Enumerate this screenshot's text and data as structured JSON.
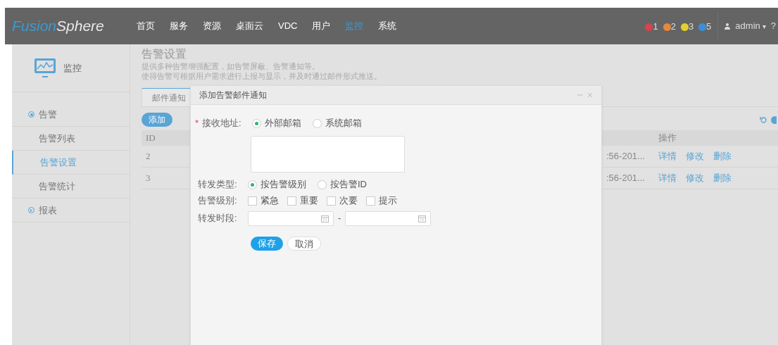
{
  "header": {
    "logo": {
      "part1": "Fusion",
      "part2": "Sphere"
    },
    "nav": [
      {
        "label": "首页",
        "selected": false
      },
      {
        "label": "服务",
        "selected": false
      },
      {
        "label": "资源",
        "selected": false
      },
      {
        "label": "桌面云",
        "selected": false
      },
      {
        "label": "VDC",
        "selected": false
      },
      {
        "label": "用户",
        "selected": false
      },
      {
        "label": "监控",
        "selected": true
      },
      {
        "label": "系统",
        "selected": false
      }
    ],
    "alarms": [
      {
        "count": "1",
        "color": "#d9434e"
      },
      {
        "count": "2",
        "color": "#e8883a"
      },
      {
        "count": "3",
        "color": "#e3cf2e"
      },
      {
        "count": "5",
        "color": "#3b8fd9"
      }
    ],
    "user": "admin",
    "user_caret": "▾",
    "help": "?"
  },
  "sidebar": {
    "title": "监控",
    "items": [
      {
        "label": "告警",
        "kind": "group",
        "expanded": true,
        "selected": false
      },
      {
        "label": "告警列表",
        "kind": "item",
        "selected": false
      },
      {
        "label": "告警设置",
        "kind": "item",
        "selected": true
      },
      {
        "label": "告警统计",
        "kind": "item",
        "selected": false
      },
      {
        "label": "报表",
        "kind": "group",
        "expanded": false,
        "selected": false
      }
    ]
  },
  "page": {
    "title": "告警设置",
    "description": [
      "提供多种告警增强配置，如告警屏蔽、告警通知等。",
      "使得告警可根据用户需求进行上报与显示，并及时通过邮件形式推送。"
    ],
    "tabs": [
      {
        "label": "邮件通知",
        "selected": true
      }
    ],
    "add_button": "添加",
    "table": {
      "columns": [
        "ID",
        "操作"
      ],
      "rows": [
        {
          "id": "2",
          "time": ":56-201...",
          "actions": [
            "详情",
            "修改",
            "删除"
          ]
        },
        {
          "id": "3",
          "time": ":56-201...",
          "actions": [
            "详情",
            "修改",
            "删除"
          ]
        }
      ]
    }
  },
  "dialog": {
    "title": "添加告警邮件通知",
    "receive": {
      "label": "接收地址:",
      "required_mark": "*",
      "options": [
        {
          "label": "外部邮箱",
          "selected": true
        },
        {
          "label": "系统邮箱",
          "selected": false
        }
      ]
    },
    "forward_type": {
      "label": "转发类型:",
      "options": [
        {
          "label": "按告警级别",
          "selected": true
        },
        {
          "label": "按告警ID",
          "selected": false
        }
      ]
    },
    "levels": {
      "label": "告警级别:",
      "options": [
        {
          "label": "紧急",
          "checked": false
        },
        {
          "label": "重要",
          "checked": false
        },
        {
          "label": "次要",
          "checked": false
        },
        {
          "label": "提示",
          "checked": false
        }
      ]
    },
    "period": {
      "label": "转发时段:",
      "separator": "-"
    },
    "buttons": {
      "save": "保存",
      "cancel": "取消"
    }
  }
}
